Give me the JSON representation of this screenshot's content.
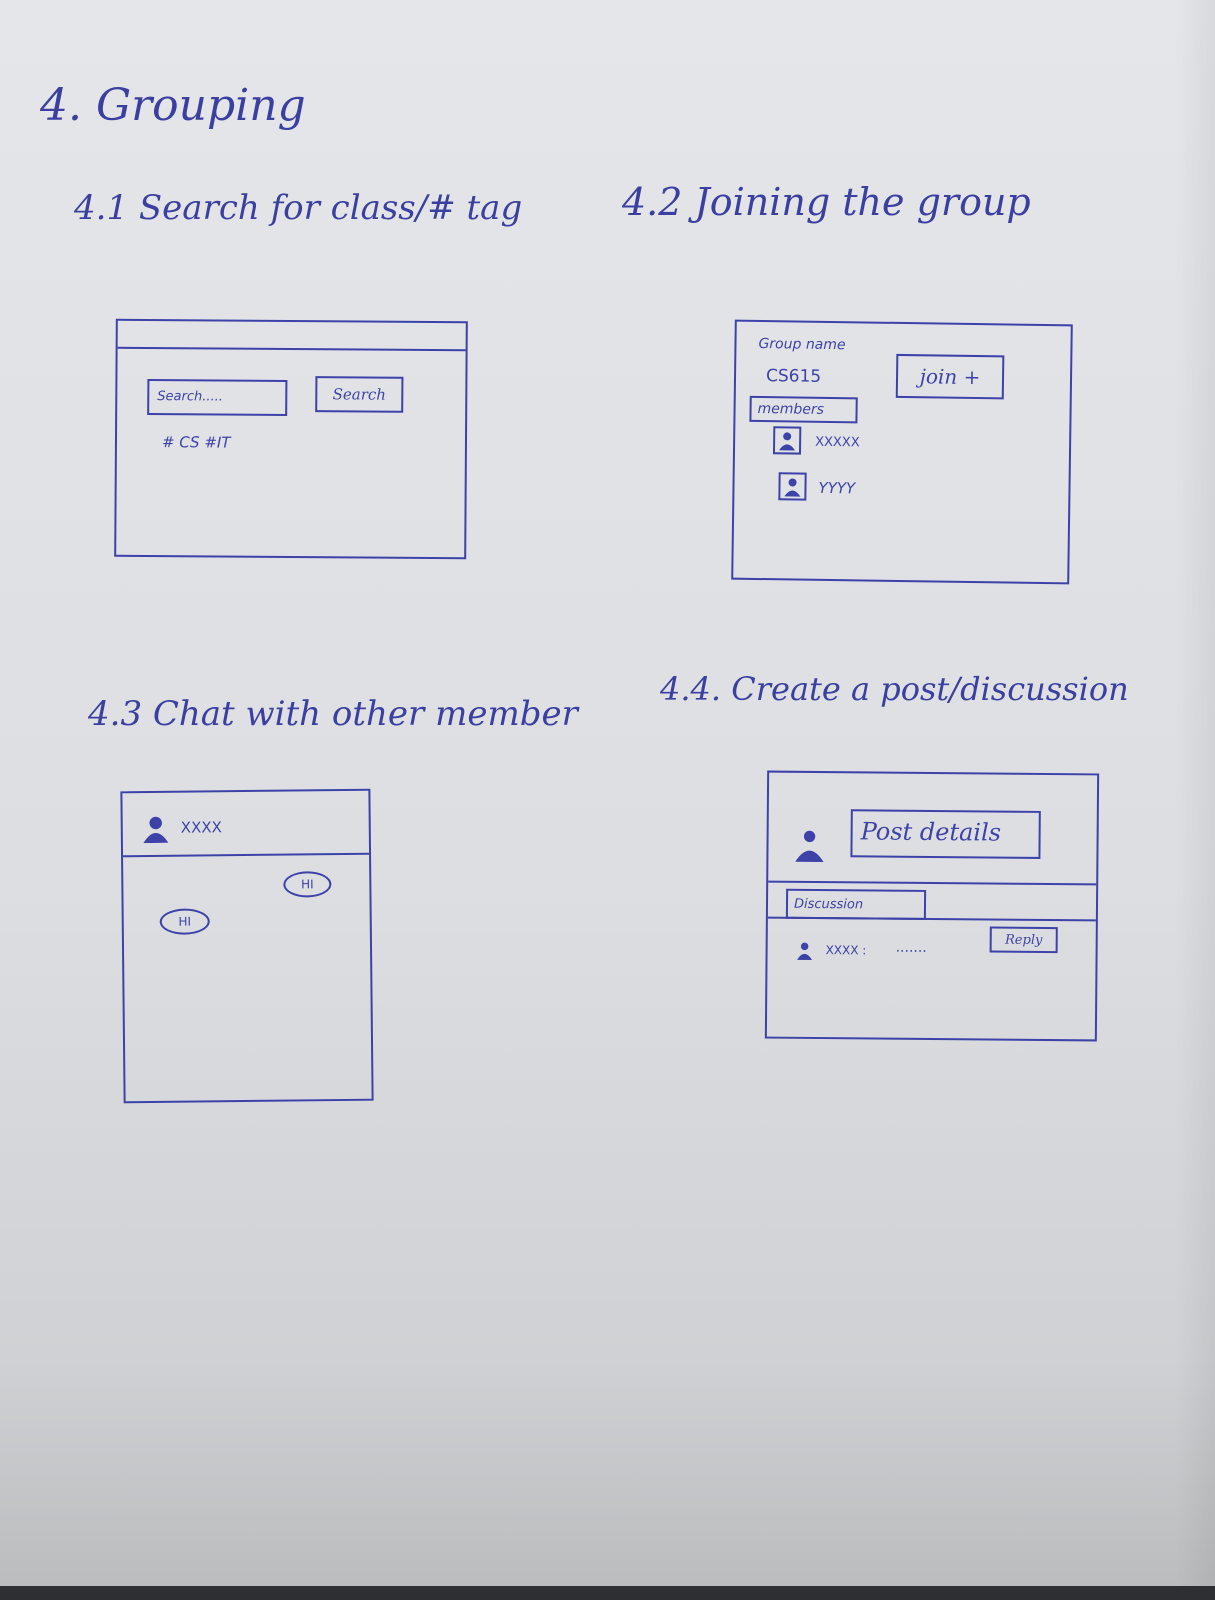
{
  "heading": "4. Grouping",
  "section_1": {
    "title": "4.1 Search for class/# tag",
    "search_placeholder": "Search.....",
    "search_button": "Search",
    "tags": "# CS #IT"
  },
  "section_2": {
    "title": "4.2 Joining the group",
    "group_name_label": "Group name",
    "group_name_value": "CS615",
    "join_button": "join +",
    "members_tab": "members",
    "members": [
      "XXXXX",
      "YYYY"
    ]
  },
  "section_3": {
    "title": "4.3 Chat with other member",
    "chat_user": "XXXX",
    "sent_message": "HI",
    "received_message": "HI"
  },
  "section_4": {
    "title": "4.4. Create a post/discussion",
    "post_details": "Post details",
    "discussion_tab": "Discussion",
    "comment_user": "XXXX :",
    "comment_text": ".......",
    "reply_button": "Reply"
  },
  "colors": {
    "ink": "#3d42a8",
    "paper": "#e2e4e8"
  }
}
